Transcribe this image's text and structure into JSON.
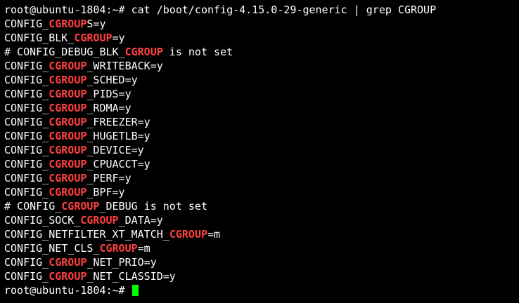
{
  "terminal": {
    "colors": {
      "background": "#000000",
      "text": "#ffffff",
      "highlight": "#ff4040",
      "cursor": "#00ff00"
    },
    "command_line": {
      "prompt": "root@ubuntu-1804:~# ",
      "command": "cat /boot/config-4.15.0-29-generic | grep CGROUP"
    },
    "output": [
      {
        "before": "CONFIG_",
        "match": "CGROUP",
        "after": "S=y"
      },
      {
        "before": "CONFIG_BLK_",
        "match": "CGROUP",
        "after": "=y"
      },
      {
        "before": "# CONFIG_DEBUG_BLK_",
        "match": "CGROUP",
        "after": " is not set"
      },
      {
        "before": "CONFIG_",
        "match": "CGROUP",
        "after": "_WRITEBACK=y"
      },
      {
        "before": "CONFIG_",
        "match": "CGROUP",
        "after": "_SCHED=y"
      },
      {
        "before": "CONFIG_",
        "match": "CGROUP",
        "after": "_PIDS=y"
      },
      {
        "before": "CONFIG_",
        "match": "CGROUP",
        "after": "_RDMA=y"
      },
      {
        "before": "CONFIG_",
        "match": "CGROUP",
        "after": "_FREEZER=y"
      },
      {
        "before": "CONFIG_",
        "match": "CGROUP",
        "after": "_HUGETLB=y"
      },
      {
        "before": "CONFIG_",
        "match": "CGROUP",
        "after": "_DEVICE=y"
      },
      {
        "before": "CONFIG_",
        "match": "CGROUP",
        "after": "_CPUACCT=y"
      },
      {
        "before": "CONFIG_",
        "match": "CGROUP",
        "after": "_PERF=y"
      },
      {
        "before": "CONFIG_",
        "match": "CGROUP",
        "after": "_BPF=y"
      },
      {
        "before": "# CONFIG_",
        "match": "CGROUP",
        "after": "_DEBUG is not set"
      },
      {
        "before": "CONFIG_SOCK_",
        "match": "CGROUP",
        "after": "_DATA=y"
      },
      {
        "before": "CONFIG_NETFILTER_XT_MATCH_",
        "match": "CGROUP",
        "after": "=m"
      },
      {
        "before": "CONFIG_NET_CLS_",
        "match": "CGROUP",
        "after": "=m"
      },
      {
        "before": "CONFIG_",
        "match": "CGROUP",
        "after": "_NET_PRIO=y"
      },
      {
        "before": "CONFIG_",
        "match": "CGROUP",
        "after": "_NET_CLASSID=y"
      }
    ],
    "final_prompt": "root@ubuntu-1804:~# "
  }
}
